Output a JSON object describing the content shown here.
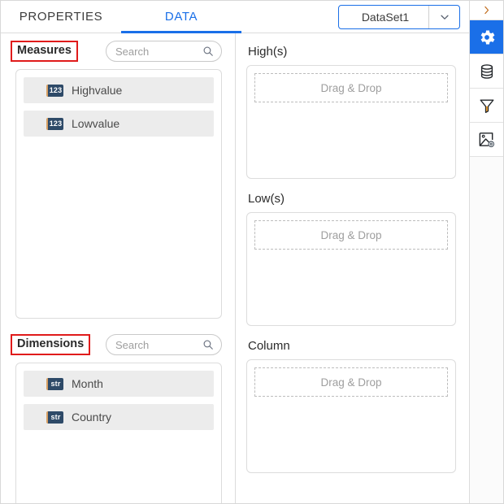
{
  "tabs": [
    {
      "label": "PROPERTIES",
      "active": false
    },
    {
      "label": "DATA",
      "active": true
    }
  ],
  "dataset_selector": {
    "value": "DataSet1",
    "icon": "chevron-down-icon"
  },
  "field_groups": [
    {
      "title": "Measures",
      "highlighted": true,
      "search": {
        "placeholder": "Search",
        "value": "",
        "icon": "search-icon"
      },
      "items": [
        {
          "badge": "123",
          "label": "Highvalue"
        },
        {
          "badge": "123",
          "label": "Lowvalue"
        }
      ]
    },
    {
      "title": "Dimensions",
      "highlighted": true,
      "search": {
        "placeholder": "Search",
        "value": "",
        "icon": "search-icon"
      },
      "items": [
        {
          "badge": "str",
          "label": "Month"
        },
        {
          "badge": "str",
          "label": "Country"
        }
      ]
    }
  ],
  "shelves": [
    {
      "title": "High(s)",
      "dropzone_label": "Drag & Drop"
    },
    {
      "title": "Low(s)",
      "dropzone_label": "Drag & Drop"
    },
    {
      "title": "Column",
      "dropzone_label": "Drag & Drop"
    }
  ],
  "rail": [
    {
      "icon": "chevron-right-icon",
      "name": "expand-panel-button",
      "active": false
    },
    {
      "icon": "gear-icon",
      "name": "settings-button",
      "active": true
    },
    {
      "icon": "database-icon",
      "name": "data-button",
      "active": false
    },
    {
      "icon": "filter-funnel-icon",
      "name": "filter-button",
      "active": false
    },
    {
      "icon": "image-settings-icon",
      "name": "image-settings-button",
      "active": false
    }
  ],
  "colors": {
    "accent_blue": "#1a6fe8",
    "highlight_red": "#e01b1b",
    "badge_navy": "#2e4a68",
    "badge_edge_orange": "#d9a063",
    "row_gray": "#ececec",
    "border_gray": "#dcdcdc",
    "placeholder_gray": "#9e9e9e"
  }
}
